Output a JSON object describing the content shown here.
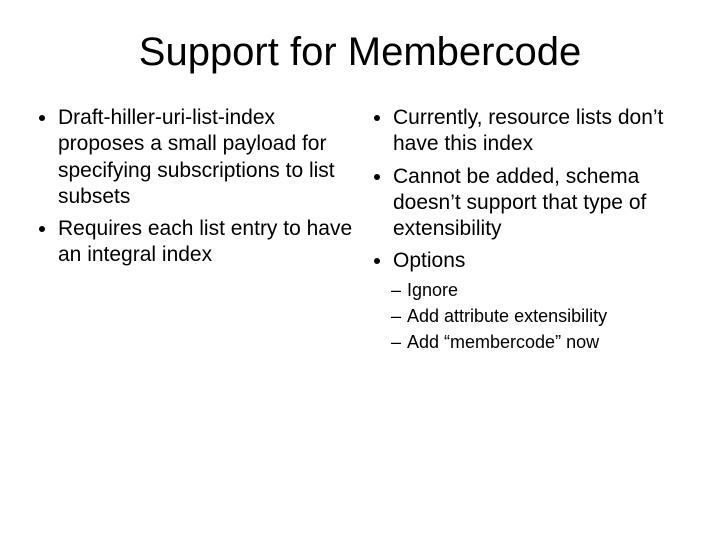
{
  "title": "Support for Membercode",
  "left": {
    "items": [
      "Draft-hiller-uri-list-index proposes a small payload for specifying subscriptions to list subsets",
      "Requires each list entry to have an integral index"
    ]
  },
  "right": {
    "items": [
      "Currently, resource lists don’t have this index",
      "Cannot be added, schema doesn’t support that type of extensibility",
      "Options"
    ],
    "options_sub": [
      "Ignore",
      "Add attribute extensibility",
      "Add “membercode” now"
    ]
  }
}
